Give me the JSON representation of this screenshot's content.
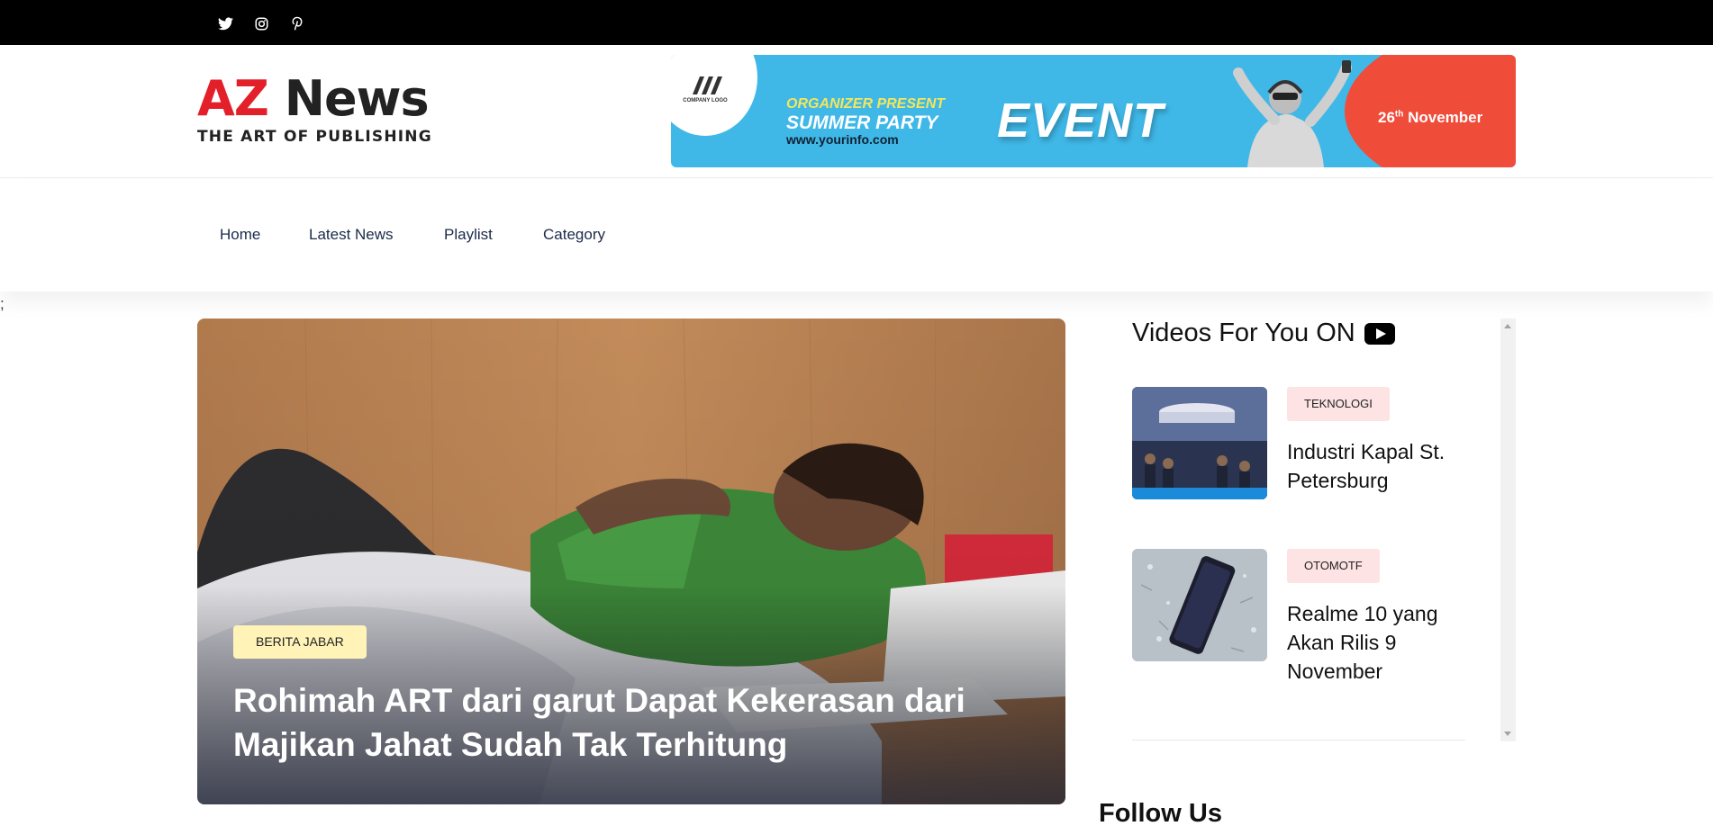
{
  "social": [
    {
      "icon": "twitter-icon"
    },
    {
      "icon": "instagram-icon"
    },
    {
      "icon": "pinterest-icon"
    }
  ],
  "logo": {
    "part1": "AZ",
    "part2": "News",
    "tagline": "THE ART OF PUBLISHING"
  },
  "banner": {
    "company_logo": "COMPANY LOGO",
    "organizer": "ORGANIZER PRESENT",
    "party": "SUMMER PARTY",
    "website": "www.yourinfo.com",
    "event": "EVENT",
    "date_day": "26",
    "date_suffix": "th",
    "date_month": "November"
  },
  "nav": {
    "items": [
      "Home",
      "Latest News",
      "Playlist",
      "Category"
    ]
  },
  "stray_text": ";",
  "hero": {
    "category": "BERITA JABAR",
    "title": "Rohimah ART dari garut Dapat Kekerasan dari Majikan Jahat Sudah Tak Terhitung"
  },
  "sidebar": {
    "title": "Videos For You ON",
    "title_icon": "youtube-icon",
    "cards": [
      {
        "category": "TEKNOLOGI",
        "title": "Industri Kapal St. Petersburg"
      },
      {
        "category": "OTOMOTF",
        "title": "Realme 10 yang Akan Rilis 9 November"
      }
    ]
  },
  "follow": {
    "title": "Follow Us"
  },
  "colors": {
    "brand_red": "#e3202a",
    "nav_text": "#1b2a4a",
    "hero_badge": "#fff3b8",
    "side_badge": "#fde3e3"
  }
}
